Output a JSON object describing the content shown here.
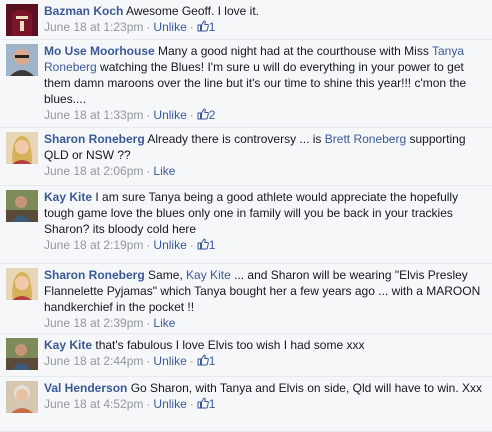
{
  "comments": [
    {
      "author": "Bazman Koch",
      "segments": [
        {
          "text": "Awesome Geoff. I love it.",
          "link": false
        }
      ],
      "time": "June 18 at 1:23pm",
      "action": "Unlike",
      "likes": "1",
      "avatar": "maroon-jersey"
    },
    {
      "author": "Mo Use Moorhouse",
      "segments": [
        {
          "text": "Many a good night had at the courthouse with Miss ",
          "link": false
        },
        {
          "text": "Tanya Roneberg",
          "link": true
        },
        {
          "text": " watching the Blues! I'm sure u will do everything in your power to get them damn maroons over the line but it's our time to shine this year!!! c'mon the blues....",
          "link": false
        }
      ],
      "time": "June 18 at 1:33pm",
      "action": "Unlike",
      "likes": "2",
      "avatar": "man-sunglasses"
    },
    {
      "author": "Sharon Roneberg",
      "segments": [
        {
          "text": "Already there is controversy ... is ",
          "link": false
        },
        {
          "text": "Brett Roneberg",
          "link": true
        },
        {
          "text": " supporting QLD or NSW ??",
          "link": false
        }
      ],
      "time": "June 18 at 2:06pm",
      "action": "Like",
      "likes": "",
      "avatar": "blonde-woman"
    },
    {
      "author": "Kay Kite",
      "segments": [
        {
          "text": "I am sure Tanya being a good athlete would appreciate the hopefully tough game love the blues only one in family will you be back in your trackies Sharon? its bloody cold here",
          "link": false
        }
      ],
      "time": "June 18 at 2:19pm",
      "action": "Unlike",
      "likes": "1",
      "avatar": "outdoor-man"
    },
    {
      "author": "Sharon Roneberg",
      "segments": [
        {
          "text": "Same, ",
          "link": false
        },
        {
          "text": "Kay Kite",
          "link": true
        },
        {
          "text": " ... and Sharon will be wearing \"Elvis Presley Flannelette Pyjamas\" which Tanya bought her a few years ago ... with a MAROON handkerchief in the pocket !!",
          "link": false
        }
      ],
      "time": "June 18 at 2:39pm",
      "action": "Like",
      "likes": "",
      "avatar": "blonde-woman"
    },
    {
      "author": "Kay Kite",
      "segments": [
        {
          "text": "that's fabulous I love Elvis too wish I had some xxx",
          "link": false
        }
      ],
      "time": "June 18 at 2:44pm",
      "action": "Unlike",
      "likes": "1",
      "avatar": "outdoor-man"
    },
    {
      "author": "Val Henderson",
      "segments": [
        {
          "text": "Go Sharon, with Tanya and Elvis on side, Qld will have to win. Xxx",
          "link": false
        }
      ],
      "time": "June 18 at 4:52pm",
      "action": "Unlike",
      "likes": "1",
      "avatar": "older-woman"
    }
  ]
}
